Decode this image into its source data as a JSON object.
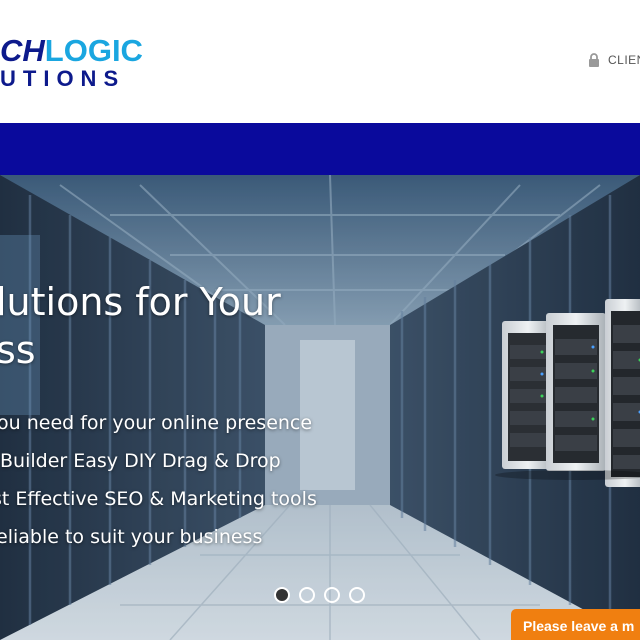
{
  "header": {
    "logo_top_first": "CH",
    "logo_top_rest": "LOGIC",
    "logo_bottom": "UTIONS",
    "client_area_label": "CLIEN",
    "lock_icon": "lock-icon"
  },
  "colors": {
    "brand_dark": "#0d1a8c",
    "brand_light": "#1aa6e0",
    "nav_bg": "#0a0a9c",
    "chat_tab": "#f07f10"
  },
  "hero": {
    "title_line1": "lutions for Your",
    "title_line2": "ss",
    "features": [
      "ou need for your online presence",
      "Builder Easy DIY Drag & Drop",
      "st Effective SEO & Marketing tools",
      "eliable to suit your business"
    ],
    "slides": 4,
    "active_slide": 1
  },
  "chat": {
    "label": "Please leave a m"
  }
}
